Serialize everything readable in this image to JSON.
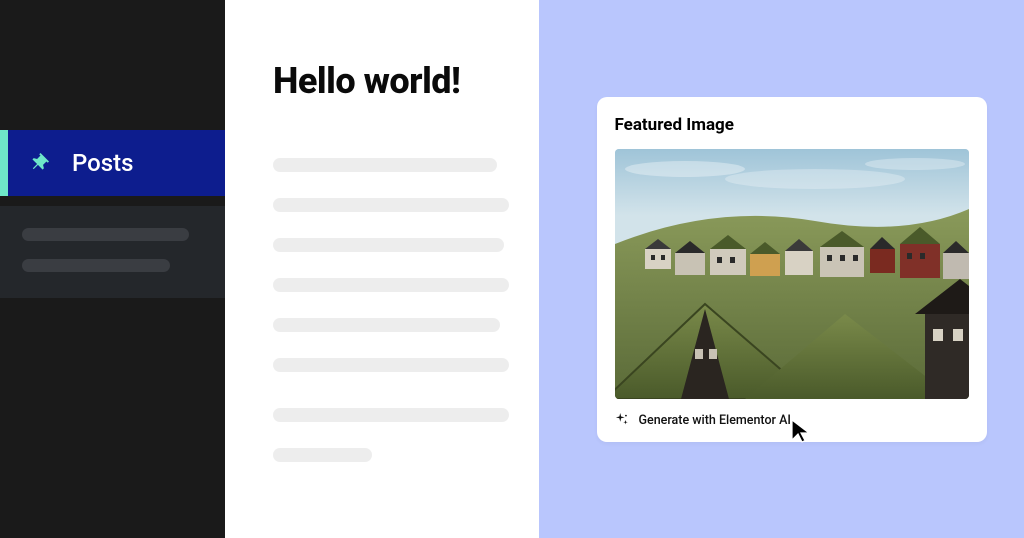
{
  "sidebar": {
    "active_item_label": "Posts"
  },
  "editor": {
    "post_title": "Hello world!"
  },
  "featured_panel": {
    "heading": "Featured Image",
    "generate_label": "Generate with Elementor AI"
  }
}
